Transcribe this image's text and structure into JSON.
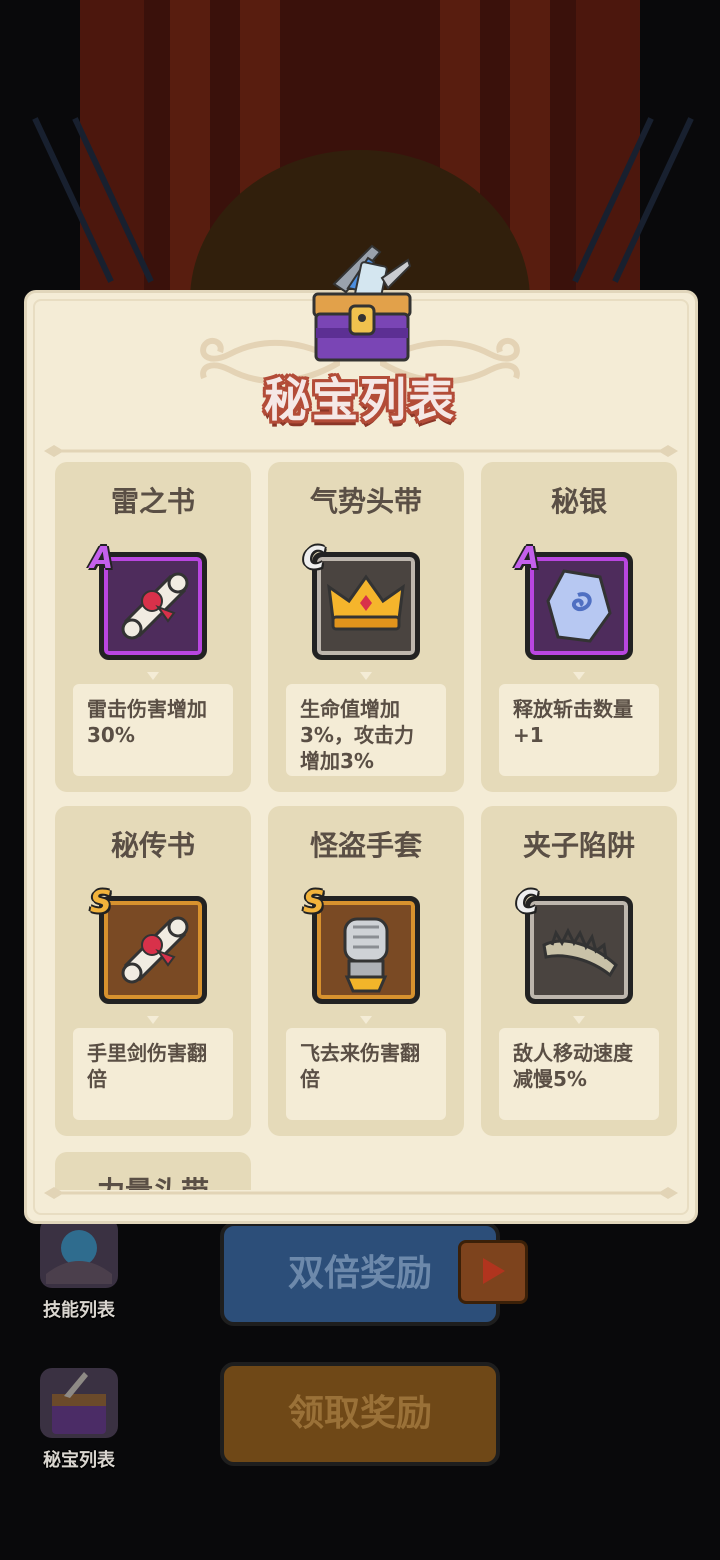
{
  "popup": {
    "title": "秘宝列表",
    "items": [
      {
        "name": "雷之书",
        "rarity": "A",
        "icon": "scroll-icon",
        "desc": "雷击伤害增加\n30%"
      },
      {
        "name": "气势头带",
        "rarity": "C",
        "icon": "crown-icon",
        "desc": "生命值增加\n3%，攻击力\n增加3%"
      },
      {
        "name": "秘银",
        "rarity": "A",
        "icon": "mithril-stone-icon",
        "desc": "释放斩击数量\n+1"
      },
      {
        "name": "秘传书",
        "rarity": "S",
        "icon": "scroll-icon",
        "desc": "手里剑伤害翻\n倍"
      },
      {
        "name": "怪盗手套",
        "rarity": "S",
        "icon": "gauntlet-icon",
        "desc": "飞去来伤害翻\n倍"
      },
      {
        "name": "夹子陷阱",
        "rarity": "C",
        "icon": "bear-trap-icon",
        "desc": "敌人移动速度\n减慢5%"
      },
      {
        "name": "力量头带"
      }
    ]
  },
  "side_menu": {
    "skills_label": "技能列表",
    "treasures_label": "秘宝列表"
  },
  "buttons": {
    "double_reward": "双倍奖励",
    "claim_reward": "领取奖励"
  },
  "colors": {
    "panel_bg": "#f4ecd6",
    "card_bg": "#e5dab9",
    "rarity_A": "#c460ec",
    "rarity_C": "#bdb6ad",
    "rarity_S": "#d8922e",
    "title_outline": "#b34c38"
  }
}
